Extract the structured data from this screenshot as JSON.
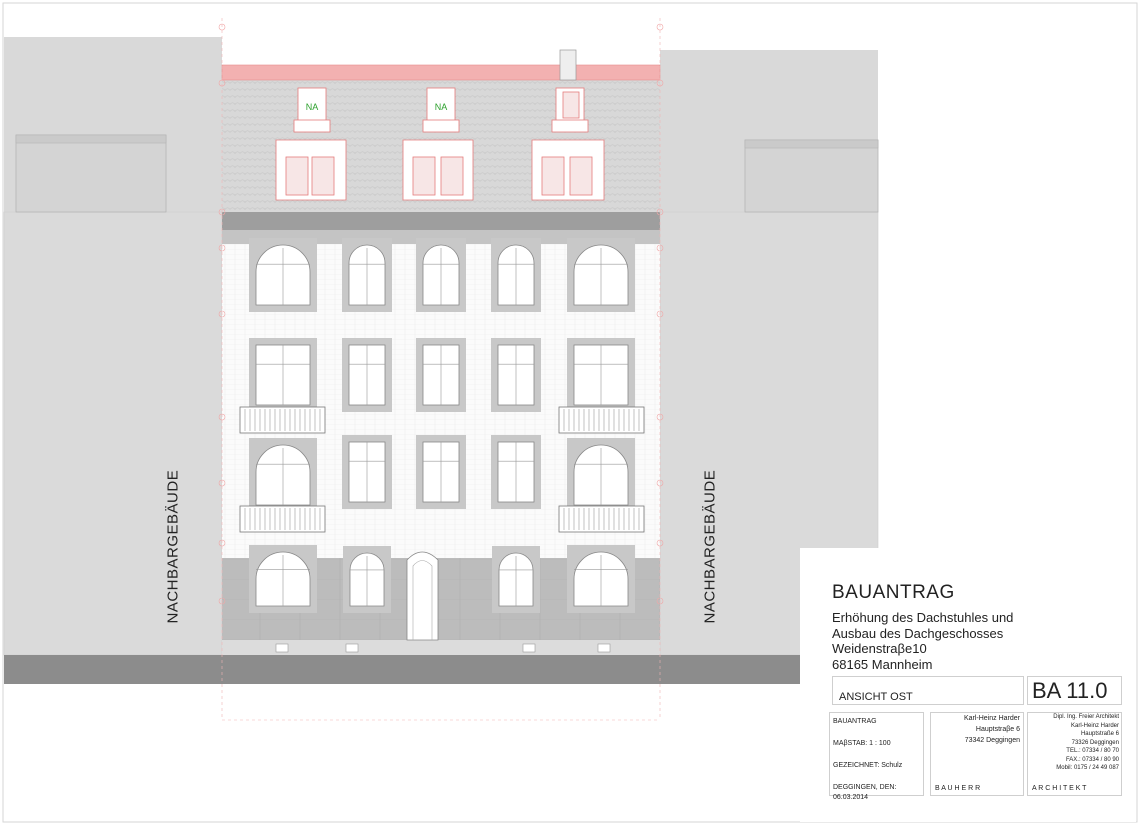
{
  "labels": {
    "neighbor_left": "NACHBARGEBÄUDE",
    "neighbor_right": "NACHBARGEBÄUDE",
    "na_left": "NA",
    "na_middle": "NA"
  },
  "title_block": {
    "heading": "BAUANTRAG",
    "line1": "Erhöhung des Dachstuhles und",
    "line2": "Ausbau des Dachgeschosses",
    "line3": "Weidenstraβe10",
    "line4": "68165 Mannheim",
    "view": "ANSICHT OST",
    "sheet_no": "BA 11.0",
    "col1": {
      "type": "BAUANTRAG",
      "scale": "MAβSTAB: 1 : 100",
      "drawn": "GEZEICHNET: Schulz",
      "date": "DEGGINGEN, DEN: 06.03.2014"
    },
    "client": {
      "name": "Karl-Heinz Harder",
      "street": "Hauptstraβe 6",
      "city": "73342 Deggingen",
      "role": "B A U H E R R"
    },
    "architect": {
      "title": "Dipl. Ing. Freier Architekt",
      "name": "Karl-Heinz Harder",
      "street": "Hauptstraße 6",
      "city": "73326 Deggingen",
      "tel": "TEL.: 07334 / 80 70",
      "fax": "FAX.: 07334 / 80 90",
      "mobil": "Mobil: 0175 / 24 49 087",
      "role": "A R C H I T E K T"
    }
  },
  "colors": {
    "neighbor_fill": "#d9d9d9",
    "ground_fill": "#8c8c8c",
    "roof_red": "#f3b1b1",
    "plinth_fill": "#bdbdbd",
    "frame_gray": "#c8c8c8"
  }
}
